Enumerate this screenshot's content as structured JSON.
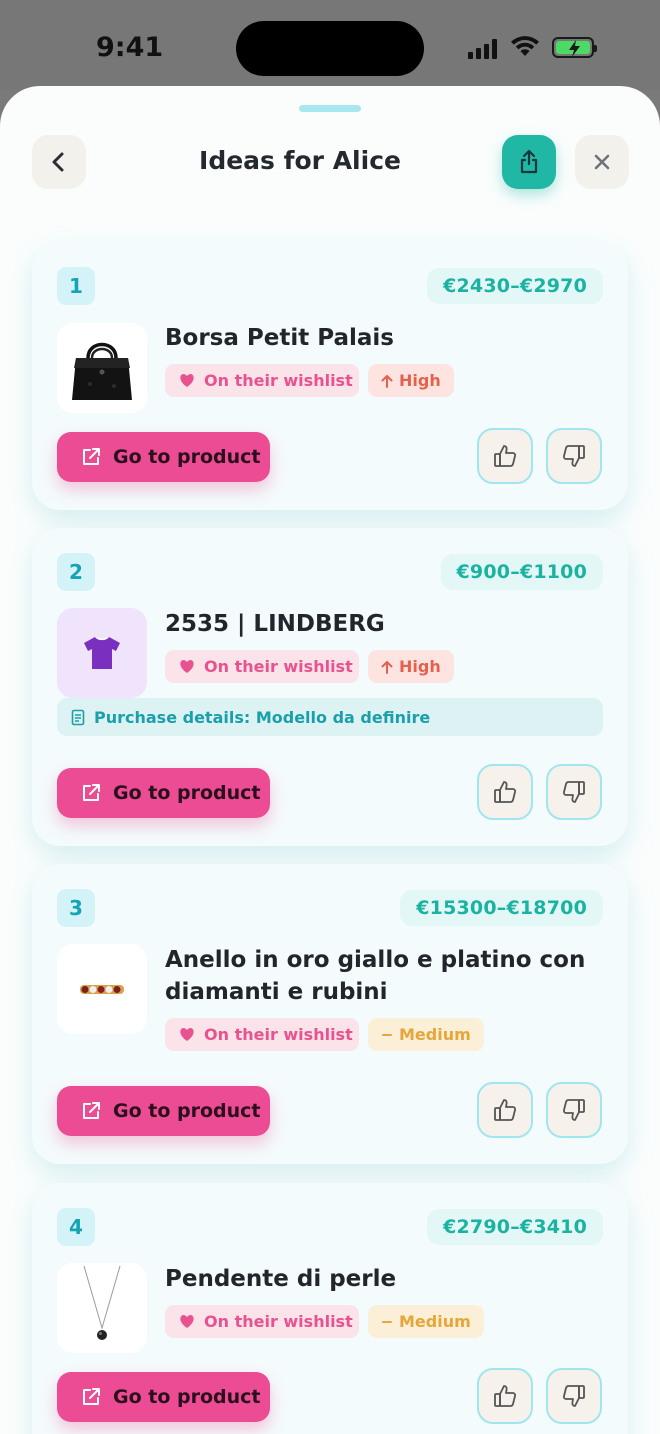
{
  "status_bar": {
    "time": "9:41"
  },
  "header": {
    "title": "Ideas for Alice"
  },
  "cards": [
    {
      "number": "1",
      "price": "€2430–€2970",
      "name": "Borsa Petit Palais",
      "wishlist": "On their wishlist",
      "priority": "High",
      "priority_level": "high",
      "go": "Go to product"
    },
    {
      "number": "2",
      "price": "€900–€1100",
      "name": "2535 | LINDBERG",
      "wishlist": "On their wishlist",
      "priority": "High",
      "priority_level": "high",
      "details": "Purchase details: Modello da definire",
      "go": "Go to product"
    },
    {
      "number": "3",
      "price": "€15300–€18700",
      "name": "Anello in oro giallo e platino con diamanti e rubini",
      "wishlist": "On their wishlist",
      "priority": "Medium",
      "priority_level": "medium",
      "go": "Go to product"
    },
    {
      "number": "4",
      "price": "€2790–€3410",
      "name": "Pendente di perle",
      "wishlist": "On their wishlist",
      "priority": "Medium",
      "priority_level": "medium",
      "go": "Go to product"
    }
  ],
  "colors": {
    "accent": "#20b8a5",
    "pink": "#ec4c93",
    "teal_text": "#1ab3a1"
  }
}
